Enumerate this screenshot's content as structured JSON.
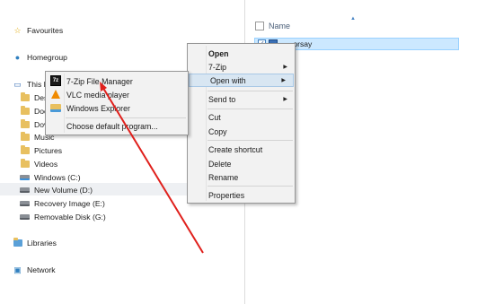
{
  "nav": {
    "favourites": "Favourites",
    "homegroup": "Homegroup",
    "this_pc": "This PC",
    "folders": [
      "Des",
      "Doc",
      "Dov",
      "Music",
      "Pictures",
      "Videos"
    ],
    "drives": [
      "Windows (C:)",
      "New Volume (D:)",
      "Recovery Image (E:)",
      "Removable Disk (G:)"
    ],
    "libraries": "Libraries",
    "network": "Network"
  },
  "file_list": {
    "column_name": "Name",
    "selected_file": "... _orsay"
  },
  "context_menu": {
    "items": [
      "Open",
      "7-Zip",
      "Open with",
      "Send to",
      "Cut",
      "Copy",
      "Create shortcut",
      "Delete",
      "Rename",
      "Properties"
    ]
  },
  "open_with_menu": {
    "items": [
      "7-Zip File Manager",
      "VLC media player",
      "Windows Explorer",
      "Choose default program..."
    ],
    "icons": [
      "7zip-icon",
      "vlc-icon",
      "windows-explorer-icon"
    ]
  },
  "colors": {
    "annotation_arrow": "#e0201c",
    "highlight": "#cce8ff"
  }
}
